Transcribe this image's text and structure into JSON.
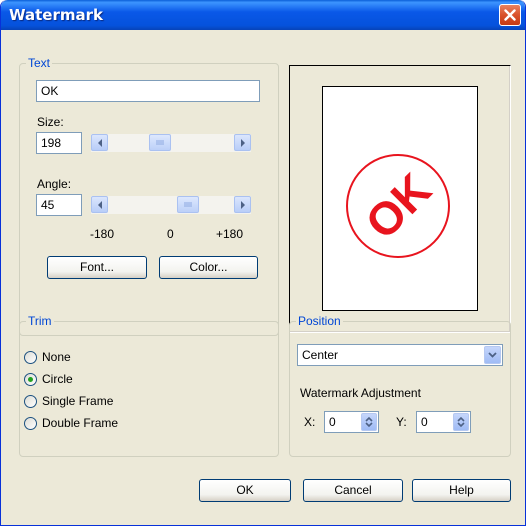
{
  "window": {
    "title": "Watermark"
  },
  "text_group": {
    "legend": "Text",
    "text_value": "OK",
    "size_label": "Size:",
    "size_value": "198",
    "angle_label": "Angle:",
    "angle_value": "45",
    "angle_min": "-180",
    "angle_mid": "0",
    "angle_max": "+180",
    "font_button": "Font...",
    "color_button": "Color..."
  },
  "preview": {
    "watermark_text": "OK",
    "watermark_color": "#e8141e"
  },
  "trim_group": {
    "legend": "Trim",
    "options": [
      {
        "label": "None",
        "checked": false
      },
      {
        "label": "Circle",
        "checked": true
      },
      {
        "label": "Single Frame",
        "checked": false
      },
      {
        "label": "Double Frame",
        "checked": false
      }
    ]
  },
  "position_group": {
    "legend": "Position",
    "selected": "Center",
    "adjustment_label": "Watermark Adjustment",
    "x_label": "X:",
    "x_value": "0",
    "y_label": "Y:",
    "y_value": "0"
  },
  "buttons": {
    "ok": "OK",
    "cancel": "Cancel",
    "help": "Help"
  }
}
